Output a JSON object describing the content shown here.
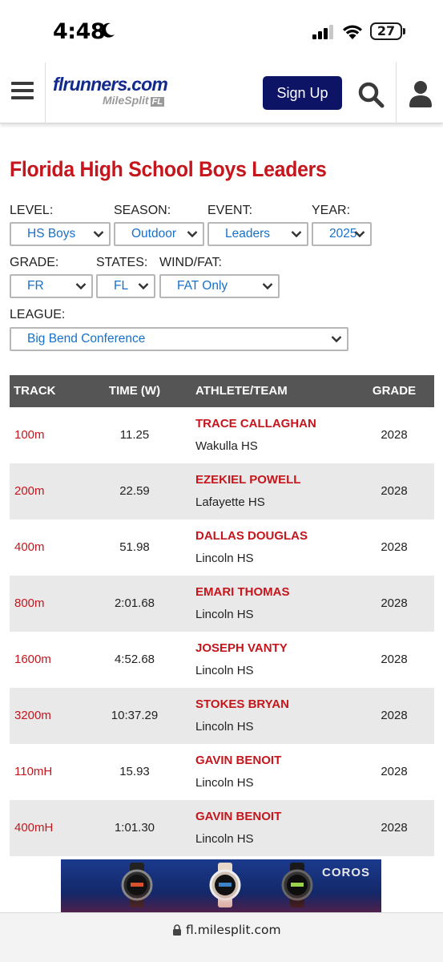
{
  "status_bar": {
    "time": "4:48",
    "battery": "27"
  },
  "header": {
    "logo_main": "flrunners.com",
    "logo_sub": "MileSplit",
    "logo_state": "FL",
    "signup_label": "Sign Up"
  },
  "page": {
    "title": "Florida High School Boys Leaders"
  },
  "filters": {
    "level": {
      "label": "LEVEL:",
      "value": "HS Boys"
    },
    "season": {
      "label": "SEASON:",
      "value": "Outdoor"
    },
    "event": {
      "label": "EVENT:",
      "value": "Leaders"
    },
    "year": {
      "label": "YEAR:",
      "value": "2025"
    },
    "grade": {
      "label": "GRADE:",
      "value": "FR"
    },
    "states": {
      "label": "STATES:",
      "value": "FL"
    },
    "wind": {
      "label": "WIND/FAT:",
      "value": "FAT Only"
    },
    "league": {
      "label": "LEAGUE:",
      "value": "Big Bend Conference"
    }
  },
  "table": {
    "headers": {
      "event": "TRACK",
      "time": "TIME (W)",
      "athlete": "ATHLETE/TEAM",
      "grade": "GRADE"
    },
    "rows": [
      {
        "event": "100m",
        "time": "11.25",
        "athlete": "TRACE CALLAGHAN",
        "team": "Wakulla HS",
        "grade": "2028"
      },
      {
        "event": "200m",
        "time": "22.59",
        "athlete": "EZEKIEL POWELL",
        "team": "Lafayette HS",
        "grade": "2028"
      },
      {
        "event": "400m",
        "time": "51.98",
        "athlete": "DALLAS DOUGLAS",
        "team": "Lincoln HS",
        "grade": "2028"
      },
      {
        "event": "800m",
        "time": "2:01.68",
        "athlete": "EMARI THOMAS",
        "team": "Lincoln HS",
        "grade": "2028"
      },
      {
        "event": "1600m",
        "time": "4:52.68",
        "athlete": "JOSEPH VANTY",
        "team": "Lincoln HS",
        "grade": "2028"
      },
      {
        "event": "3200m",
        "time": "10:37.29",
        "athlete": "STOKES BRYAN",
        "team": "Lincoln HS",
        "grade": "2028"
      },
      {
        "event": "110mH",
        "time": "15.93",
        "athlete": "GAVIN BENOIT",
        "team": "Lincoln HS",
        "grade": "2028"
      },
      {
        "event": "400mH",
        "time": "1:01.30",
        "athlete": "GAVIN BENOIT",
        "team": "Lincoln HS",
        "grade": "2028"
      }
    ]
  },
  "ad": {
    "brand": "COROS"
  },
  "browser": {
    "url": "fl.milesplit.com"
  },
  "colors": {
    "accent_red": "#c4161c",
    "brand_navy": "#0d1466",
    "link_blue": "#1770c9",
    "table_header": "#555555"
  }
}
